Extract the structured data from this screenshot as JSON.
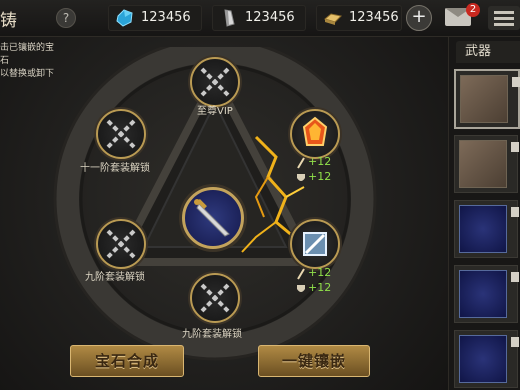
{
  "header": {
    "title_fragment": "铸",
    "help_label": "?",
    "resources": [
      {
        "icon": "blue-crystal-icon",
        "value": "123456"
      },
      {
        "icon": "silver-ingot-icon",
        "value": "123456"
      },
      {
        "icon": "gold-ingot-icon",
        "value": "123456"
      }
    ],
    "plus_label": "+",
    "mail_badge": "2"
  },
  "hint": {
    "line1": "击已镶嵌的宝石",
    "line2": "以替换或卸下"
  },
  "slots": {
    "top_label": "至尊VIP",
    "upper_left_label": "十一阶套装解锁",
    "lower_left_label": "九阶套装解锁",
    "bottom_label": "九阶套装解锁"
  },
  "stats": {
    "upper_attack": "+12",
    "upper_defense": "+12",
    "lower_attack": "+12",
    "lower_defense": "+12"
  },
  "buttons": {
    "synthesize": "宝石合成",
    "one_click_inlay": "一键镶嵌"
  },
  "side_panel": {
    "tab_label": "武器",
    "items": [
      {
        "kind": "bow",
        "selected": true
      },
      {
        "kind": "bow",
        "selected": false
      },
      {
        "kind": "sword",
        "selected": false
      },
      {
        "kind": "sword",
        "selected": false
      },
      {
        "kind": "sword",
        "selected": false
      }
    ]
  },
  "colors": {
    "frame_gold": "#b99a53",
    "stat_green": "#90e04a",
    "button_gold": "#b08a44",
    "crack_glow": "#f0b21a"
  }
}
